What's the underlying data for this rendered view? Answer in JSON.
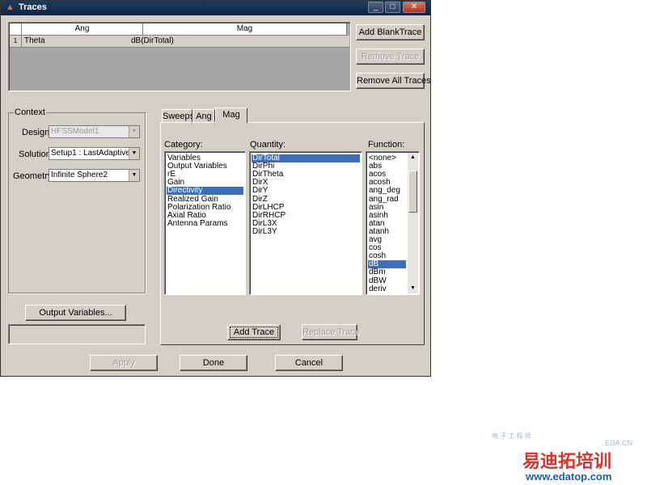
{
  "window": {
    "title": "Traces",
    "controls": {
      "minimize": "_",
      "maximize": "□",
      "close": "✕"
    }
  },
  "traces_table": {
    "columns": [
      "Ang",
      "Mag"
    ],
    "rows": [
      {
        "index": "1",
        "ang": "Theta",
        "mag": "dB(DirTotal)"
      }
    ]
  },
  "trace_buttons": {
    "add_blank": "Add BlankTrace",
    "remove": "Remove Trace",
    "remove_all": "Remove All Traces"
  },
  "context": {
    "legend": "Context",
    "design_label": "Design:",
    "design_value": "HFSSModel1",
    "solution_label": "Solution:",
    "solution_value": "Setup1 : LastAdaptive",
    "geometry_label": "Geometry:",
    "geometry_value": "Infinite Sphere2",
    "output_variables_button": "Output Variables..."
  },
  "tabs": [
    "Sweeps",
    "Ang",
    "Mag"
  ],
  "active_tab": "Mag",
  "category": {
    "label": "Category:",
    "items": [
      "Variables",
      "Output Variables",
      "rE",
      "Gain",
      "Directivity",
      "Realized Gain",
      "Polarization Ratio",
      "Axial Ratio",
      "Antenna Params"
    ],
    "selected": "Directivity"
  },
  "quantity": {
    "label": "Quantity:",
    "items": [
      "DirTotal",
      "DirPhi",
      "DirTheta",
      "DirX",
      "DirY",
      "DirZ",
      "DirLHCP",
      "DirRHCP",
      "DirL3X",
      "DirL3Y"
    ],
    "selected": "DirTotal"
  },
  "function": {
    "label": "Function:",
    "items": [
      "<none>",
      "abs",
      "acos",
      "acosh",
      "ang_deg",
      "ang_rad",
      "asin",
      "asinh",
      "atan",
      "atanh",
      "avg",
      "cos",
      "cosh",
      "dB",
      "dBm",
      "dBW",
      "deriv"
    ],
    "selected": "dB",
    "scrollbar_position": 0.1
  },
  "panel_buttons": {
    "add_trace": "Add Trace",
    "replace_trace": "Replace Trace"
  },
  "footer_buttons": {
    "apply": "Apply",
    "done": "Done",
    "cancel": "Cancel"
  },
  "watermark": {
    "small": "电 子 工 程 师",
    "edacn": "EDA.CN",
    "brand": "易迪拓培训",
    "url": "www.edatop.com",
    "colors": {
      "brand": "#d9342b",
      "url": "#1f5fa8"
    }
  },
  "colors": {
    "selection": "#3d6fb8",
    "titlebar": "#1c3d63",
    "face": "#d4d0c8",
    "grid_bg": "#a7a7a7"
  }
}
